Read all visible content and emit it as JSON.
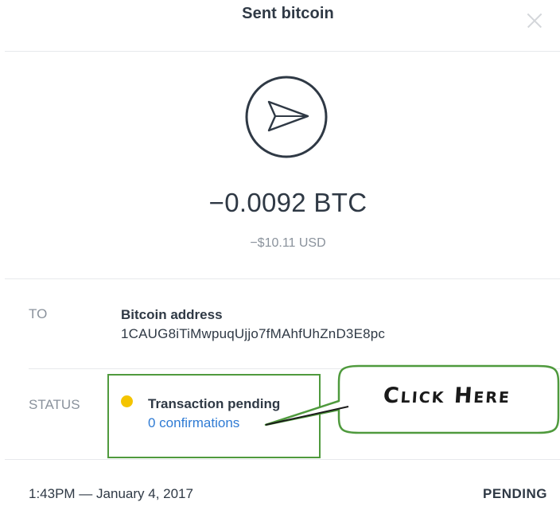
{
  "modal": {
    "title": "Sent bitcoin",
    "close_icon": "close-icon"
  },
  "transaction": {
    "icon": "send-paper-plane-icon",
    "amount_btc": "−0.0092 BTC",
    "amount_usd": "−$10.11 USD"
  },
  "details": {
    "to_label": "TO",
    "address_title": "Bitcoin address",
    "address_value": "1CAUG8iTiMwpuqUjjo7fMAhfUhZnD3E8pc",
    "status_label": "STATUS",
    "status_text": "Transaction pending",
    "status_color": "#f4c400",
    "confirmations_link": "0 confirmations"
  },
  "annotation": {
    "callout_text": "Click Here",
    "highlight_color": "#4f9a3d"
  },
  "footer": {
    "timestamp": "1:43PM — January 4, 2017",
    "status": "PENDING"
  }
}
